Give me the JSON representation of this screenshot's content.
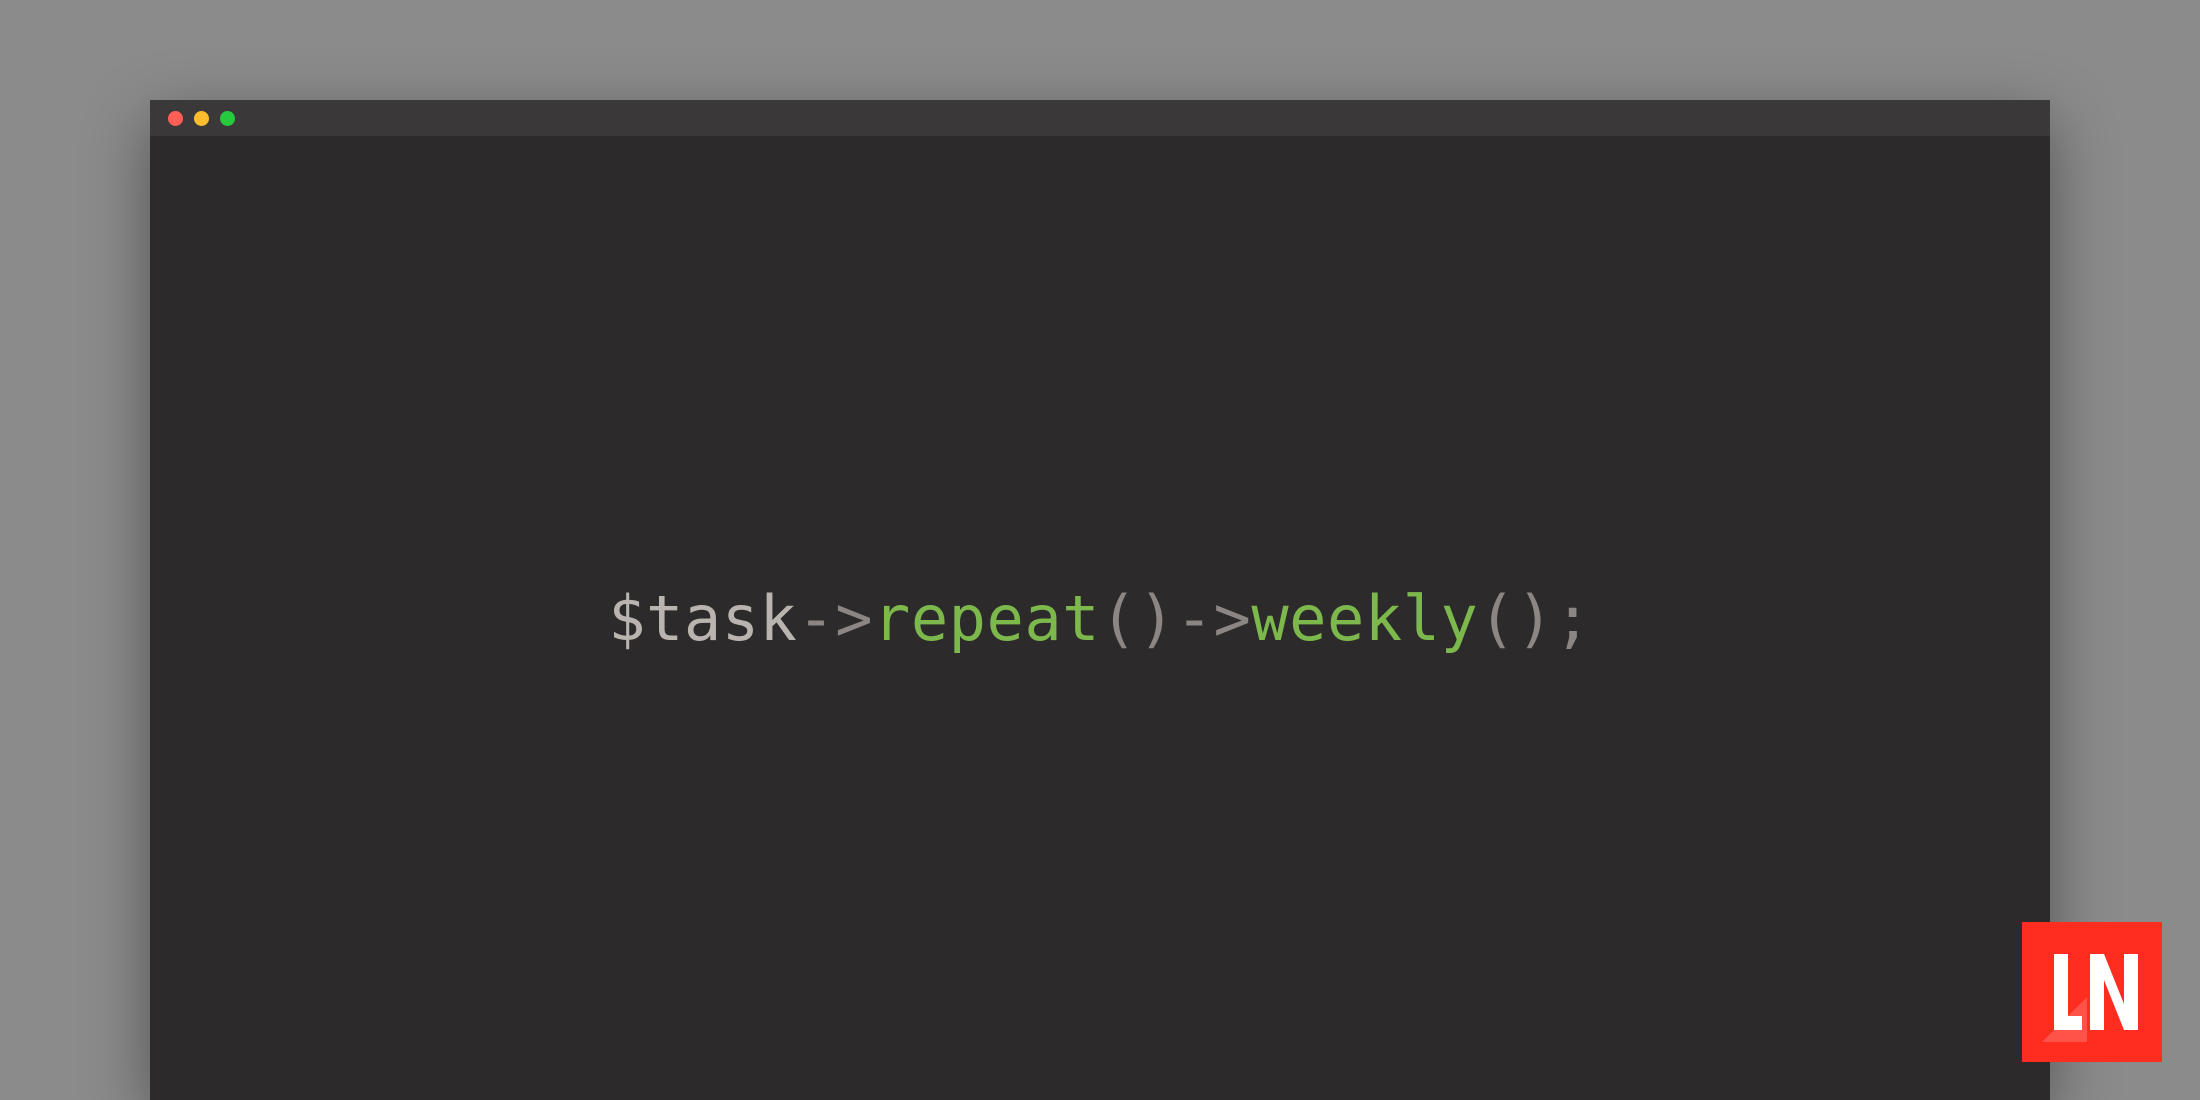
{
  "window": {
    "titlebar": {
      "close_color": "#ff5f56",
      "minimize_color": "#ffbd2e",
      "maximize_color": "#27c93f"
    }
  },
  "code": {
    "tokens": {
      "variable": "$task",
      "arrow1": "->",
      "method1": "repeat",
      "parens1": "()",
      "arrow2": "->",
      "method2": "weekly",
      "parens2": "()",
      "semicolon": ";"
    }
  },
  "logo": {
    "name": "LN",
    "bg_color": "#ff2d20"
  }
}
